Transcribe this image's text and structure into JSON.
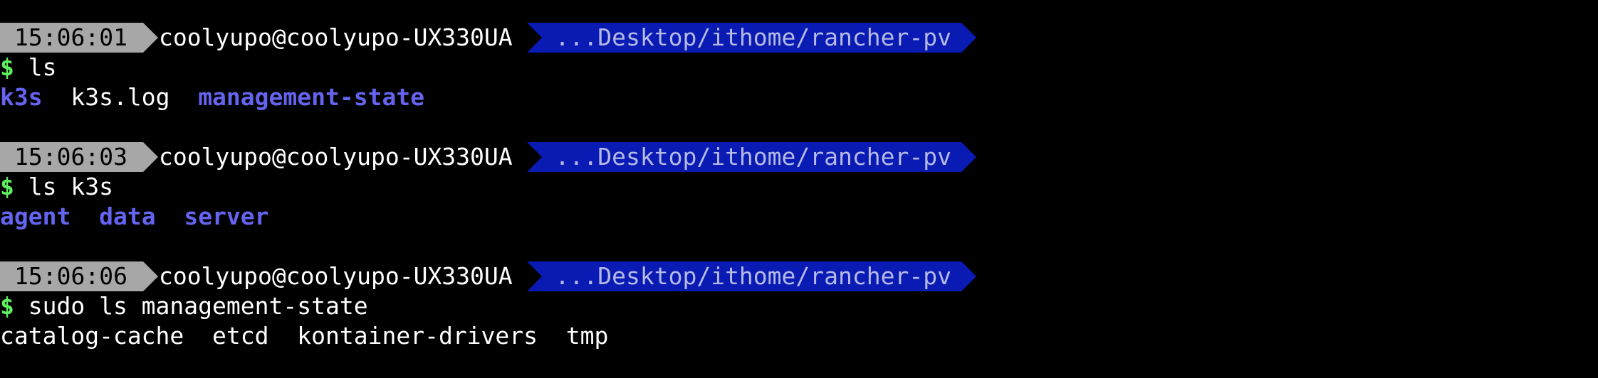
{
  "blocks": [
    {
      "time": "15:06:01",
      "user_host": "coolyupo@coolyupo-UX330UA",
      "path": "...Desktop/ithome/rancher-pv",
      "prompt_symbol": "$",
      "command": " ls",
      "output": [
        {
          "text": "k3s",
          "kind": "dir"
        },
        {
          "text": "  ",
          "kind": "space"
        },
        {
          "text": "k3s.log",
          "kind": "file"
        },
        {
          "text": "  ",
          "kind": "space"
        },
        {
          "text": "management-state",
          "kind": "dir"
        }
      ]
    },
    {
      "time": "15:06:03",
      "user_host": "coolyupo@coolyupo-UX330UA",
      "path": "...Desktop/ithome/rancher-pv",
      "prompt_symbol": "$",
      "command": " ls k3s",
      "output": [
        {
          "text": "agent",
          "kind": "dir"
        },
        {
          "text": "  ",
          "kind": "space"
        },
        {
          "text": "data",
          "kind": "dir"
        },
        {
          "text": "  ",
          "kind": "space"
        },
        {
          "text": "server",
          "kind": "dir"
        }
      ]
    },
    {
      "time": "15:06:06",
      "user_host": "coolyupo@coolyupo-UX330UA",
      "path": "...Desktop/ithome/rancher-pv",
      "prompt_symbol": "$",
      "command": " sudo ls management-state",
      "output": [
        {
          "text": "catalog-cache",
          "kind": "file"
        },
        {
          "text": "  ",
          "kind": "space"
        },
        {
          "text": "etcd",
          "kind": "file"
        },
        {
          "text": "  ",
          "kind": "space"
        },
        {
          "text": "kontainer-drivers",
          "kind": "file"
        },
        {
          "text": "  ",
          "kind": "space"
        },
        {
          "text": "tmp",
          "kind": "file"
        }
      ]
    }
  ],
  "colors": {
    "background": "#000000",
    "time_segment": "#a7a7a7",
    "path_segment": "#0a1bb4",
    "path_text": "#b5b9e6",
    "prompt_dollar": "#5ef05e",
    "directory": "#6464f0",
    "file": "#ffffff"
  }
}
